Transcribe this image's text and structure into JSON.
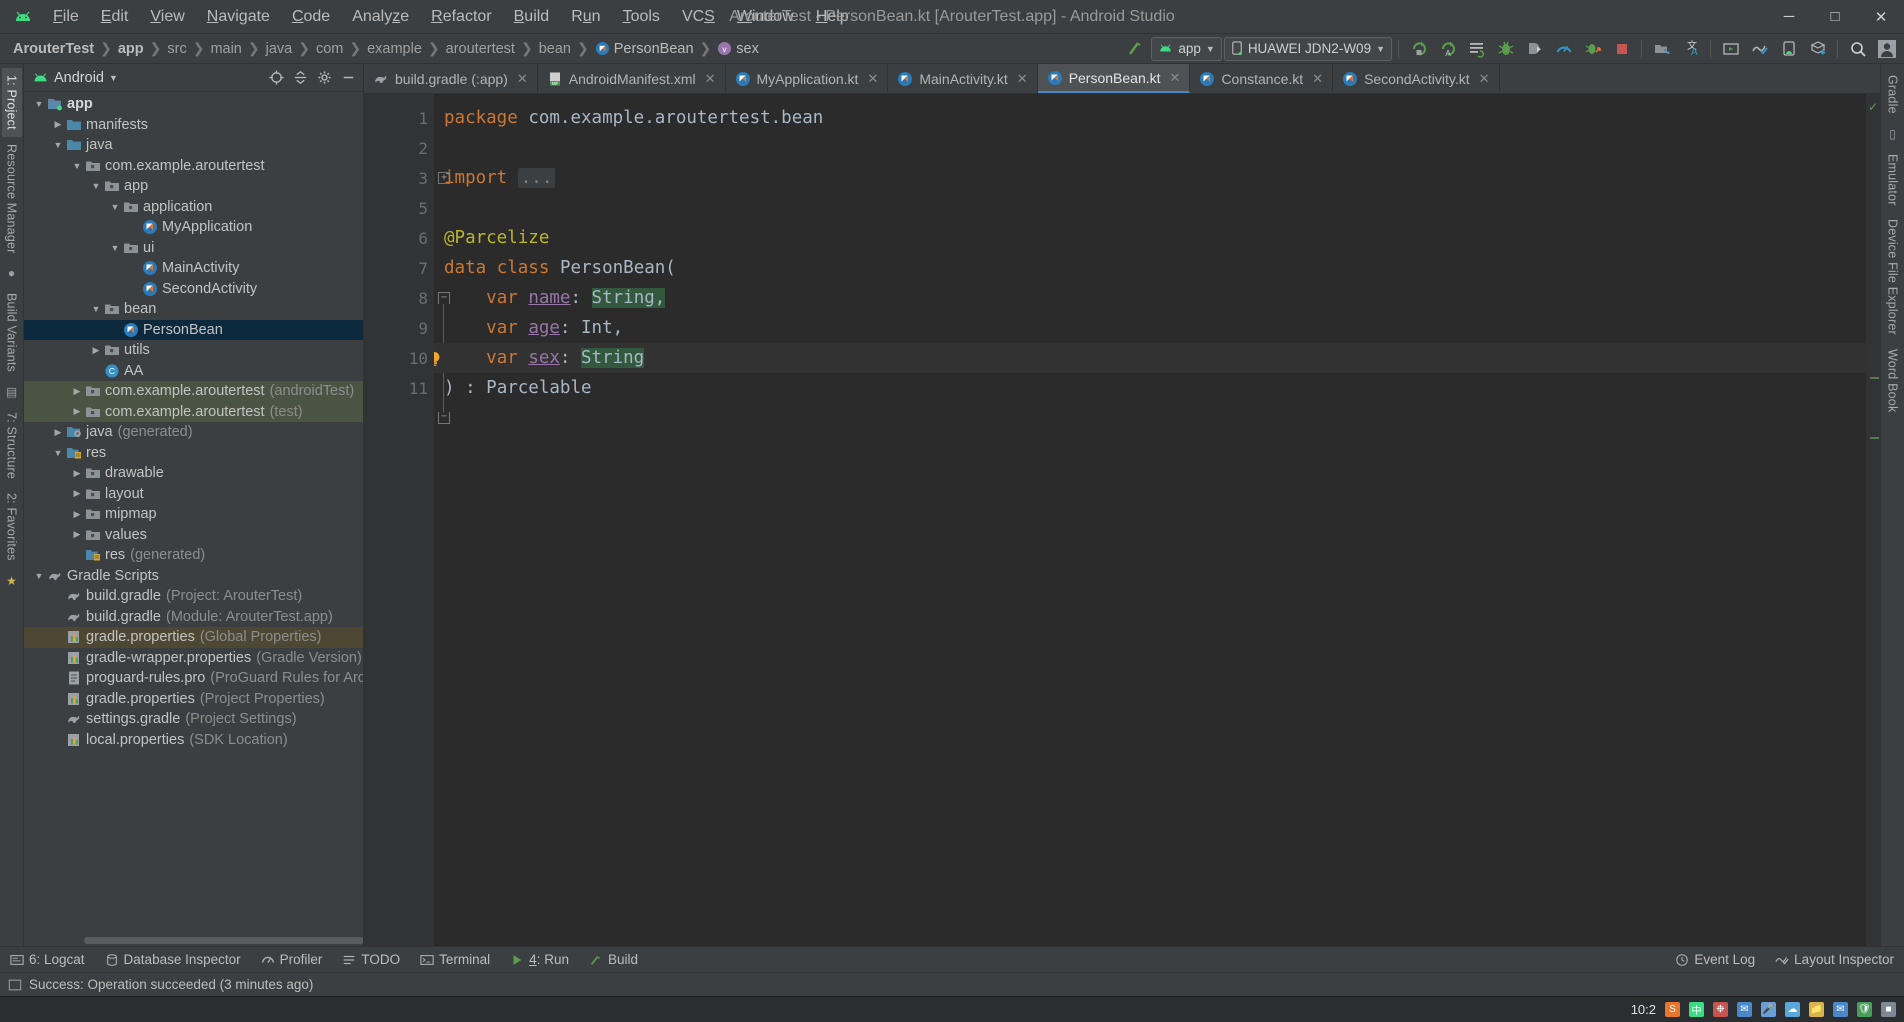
{
  "window": {
    "title": "ArouterTest - PersonBean.kt [ArouterTest.app] - Android Studio",
    "minimize": "─",
    "maximize": "☐",
    "close": "✕"
  },
  "menu": {
    "items": [
      {
        "label": "File",
        "mnemonic": "F"
      },
      {
        "label": "Edit",
        "mnemonic": "E"
      },
      {
        "label": "View",
        "mnemonic": "V"
      },
      {
        "label": "Navigate",
        "mnemonic": "N"
      },
      {
        "label": "Code",
        "mnemonic": "C"
      },
      {
        "label": "Analyze",
        "mnemonic": "z"
      },
      {
        "label": "Refactor",
        "mnemonic": "R"
      },
      {
        "label": "Build",
        "mnemonic": "B"
      },
      {
        "label": "Run",
        "mnemonic": "u"
      },
      {
        "label": "Tools",
        "mnemonic": "T"
      },
      {
        "label": "VCS",
        "mnemonic": "S"
      },
      {
        "label": "Window",
        "mnemonic": "W"
      },
      {
        "label": "Help",
        "mnemonic": "H"
      }
    ]
  },
  "breadcrumbs": [
    {
      "label": "ArouterTest",
      "icon": "",
      "style": "bold"
    },
    {
      "label": "app",
      "icon": "",
      "style": "bold"
    },
    {
      "label": "src",
      "icon": "",
      "style": "dim"
    },
    {
      "label": "main",
      "icon": "",
      "style": "dim"
    },
    {
      "label": "java",
      "icon": "",
      "style": "dim"
    },
    {
      "label": "com",
      "icon": "",
      "style": "dim"
    },
    {
      "label": "example",
      "icon": "",
      "style": "dim"
    },
    {
      "label": "aroutertest",
      "icon": "",
      "style": "dim"
    },
    {
      "label": "bean",
      "icon": "",
      "style": "dim"
    },
    {
      "label": "PersonBean",
      "icon": "kotlin-class-icon",
      "style": "normal"
    },
    {
      "label": "sex",
      "icon": "variable-icon",
      "style": "normal"
    }
  ],
  "toolbar": {
    "run_config": "app",
    "device": "HUAWEI JDN2-W09",
    "icons": [
      "make-project-icon",
      "run-icon",
      "run-with-coverage-icon",
      "apply-changes-icon",
      "debug-icon",
      "attach-debugger-icon",
      "profiler-icon",
      "stop-icon",
      "sdk-manager-icon",
      "avd-manager-icon",
      "translate-icon",
      "logcat-icon",
      "layout-inspector-icon",
      "device-explorer-icon",
      "build-variants-icon",
      "search-icon",
      "account-icon"
    ]
  },
  "left_strip": {
    "tabs": [
      {
        "label": "1: Project",
        "active": true
      },
      {
        "label": "Resource Manager",
        "active": false
      },
      {
        "label": "Build Variants",
        "active": false
      },
      {
        "label": "7: Structure",
        "active": false
      },
      {
        "label": "2: Favorites",
        "active": false
      }
    ]
  },
  "right_strip": {
    "tabs": [
      {
        "label": "Gradle",
        "active": false
      },
      {
        "label": "Emulator",
        "active": false
      },
      {
        "label": "Device File Explorer",
        "active": false
      },
      {
        "label": "Word Book",
        "active": false
      }
    ]
  },
  "project_panel": {
    "title": "Android",
    "header_icons": [
      "target-icon",
      "collapse-all-icon",
      "settings-icon",
      "hide-icon"
    ],
    "tree": [
      {
        "indent": 0,
        "arrow": "down",
        "icon": "module-icon",
        "label": "app",
        "sub": "",
        "bold": true,
        "state": ""
      },
      {
        "indent": 1,
        "arrow": "right",
        "icon": "folder-icon",
        "label": "manifests",
        "sub": "",
        "bold": false,
        "state": ""
      },
      {
        "indent": 1,
        "arrow": "down",
        "icon": "folder-icon",
        "label": "java",
        "sub": "",
        "bold": false,
        "state": ""
      },
      {
        "indent": 2,
        "arrow": "down",
        "icon": "package-icon",
        "label": "com.example.aroutertest",
        "sub": "",
        "bold": false,
        "state": ""
      },
      {
        "indent": 3,
        "arrow": "down",
        "icon": "package-icon",
        "label": "app",
        "sub": "",
        "bold": false,
        "state": ""
      },
      {
        "indent": 4,
        "arrow": "down",
        "icon": "package-icon",
        "label": "application",
        "sub": "",
        "bold": false,
        "state": ""
      },
      {
        "indent": 5,
        "arrow": "none",
        "icon": "kotlin-class-icon",
        "label": "MyApplication",
        "sub": "",
        "bold": false,
        "state": ""
      },
      {
        "indent": 4,
        "arrow": "down",
        "icon": "package-icon",
        "label": "ui",
        "sub": "",
        "bold": false,
        "state": ""
      },
      {
        "indent": 5,
        "arrow": "none",
        "icon": "kotlin-class-icon",
        "label": "MainActivity",
        "sub": "",
        "bold": false,
        "state": ""
      },
      {
        "indent": 5,
        "arrow": "none",
        "icon": "kotlin-class-icon",
        "label": "SecondActivity",
        "sub": "",
        "bold": false,
        "state": ""
      },
      {
        "indent": 3,
        "arrow": "down",
        "icon": "package-icon",
        "label": "bean",
        "sub": "",
        "bold": false,
        "state": ""
      },
      {
        "indent": 4,
        "arrow": "none",
        "icon": "kotlin-class-icon",
        "label": "PersonBean",
        "sub": "",
        "bold": false,
        "state": "sel"
      },
      {
        "indent": 3,
        "arrow": "right",
        "icon": "package-icon",
        "label": "utils",
        "sub": "",
        "bold": false,
        "state": ""
      },
      {
        "indent": 3,
        "arrow": "none",
        "icon": "java-class-icon",
        "label": "AA",
        "sub": "",
        "bold": false,
        "state": ""
      },
      {
        "indent": 2,
        "arrow": "right",
        "icon": "package-icon",
        "label": "com.example.aroutertest",
        "sub": "(androidTest)",
        "bold": false,
        "state": "test"
      },
      {
        "indent": 2,
        "arrow": "right",
        "icon": "package-icon",
        "label": "com.example.aroutertest",
        "sub": "(test)",
        "bold": false,
        "state": "test"
      },
      {
        "indent": 1,
        "arrow": "right",
        "icon": "generated-icon",
        "label": "java",
        "sub": "(generated)",
        "bold": false,
        "state": ""
      },
      {
        "indent": 1,
        "arrow": "down",
        "icon": "res-icon",
        "label": "res",
        "sub": "",
        "bold": false,
        "state": ""
      },
      {
        "indent": 2,
        "arrow": "right",
        "icon": "package-icon",
        "label": "drawable",
        "sub": "",
        "bold": false,
        "state": ""
      },
      {
        "indent": 2,
        "arrow": "right",
        "icon": "package-icon",
        "label": "layout",
        "sub": "",
        "bold": false,
        "state": ""
      },
      {
        "indent": 2,
        "arrow": "right",
        "icon": "package-icon",
        "label": "mipmap",
        "sub": "",
        "bold": false,
        "state": ""
      },
      {
        "indent": 2,
        "arrow": "right",
        "icon": "package-icon",
        "label": "values",
        "sub": "",
        "bold": false,
        "state": ""
      },
      {
        "indent": 2,
        "arrow": "none",
        "icon": "res-icon",
        "label": "res",
        "sub": "(generated)",
        "bold": false,
        "state": ""
      },
      {
        "indent": 0,
        "arrow": "down",
        "icon": "gradle-icon",
        "label": "Gradle Scripts",
        "sub": "",
        "bold": false,
        "state": ""
      },
      {
        "indent": 1,
        "arrow": "none",
        "icon": "gradle-icon",
        "label": "build.gradle",
        "sub": "(Project: ArouterTest)",
        "bold": false,
        "state": ""
      },
      {
        "indent": 1,
        "arrow": "none",
        "icon": "gradle-icon",
        "label": "build.gradle",
        "sub": "(Module: ArouterTest.app)",
        "bold": false,
        "state": ""
      },
      {
        "indent": 1,
        "arrow": "none",
        "icon": "properties-icon",
        "label": "gradle.properties",
        "sub": "(Global Properties)",
        "bold": false,
        "state": "olive"
      },
      {
        "indent": 1,
        "arrow": "none",
        "icon": "properties-icon",
        "label": "gradle-wrapper.properties",
        "sub": "(Gradle Version)",
        "bold": false,
        "state": ""
      },
      {
        "indent": 1,
        "arrow": "none",
        "icon": "file-icon",
        "label": "proguard-rules.pro",
        "sub": "(ProGuard Rules for Aroute",
        "bold": false,
        "state": ""
      },
      {
        "indent": 1,
        "arrow": "none",
        "icon": "properties-icon",
        "label": "gradle.properties",
        "sub": "(Project Properties)",
        "bold": false,
        "state": ""
      },
      {
        "indent": 1,
        "arrow": "none",
        "icon": "gradle-icon",
        "label": "settings.gradle",
        "sub": "(Project Settings)",
        "bold": false,
        "state": ""
      },
      {
        "indent": 1,
        "arrow": "none",
        "icon": "properties-icon",
        "label": "local.properties",
        "sub": "(SDK Location)",
        "bold": false,
        "state": ""
      }
    ]
  },
  "editor_tabs": [
    {
      "label": "build.gradle (:app)",
      "icon": "gradle-icon",
      "active": false
    },
    {
      "label": "AndroidManifest.xml",
      "icon": "manifest-icon",
      "active": false
    },
    {
      "label": "MyApplication.kt",
      "icon": "kotlin-class-icon",
      "active": false
    },
    {
      "label": "MainActivity.kt",
      "icon": "kotlin-class-icon",
      "active": false
    },
    {
      "label": "PersonBean.kt",
      "icon": "kotlin-class-icon",
      "active": true
    },
    {
      "label": "Constance.kt",
      "icon": "kotlin-class-icon",
      "active": false
    },
    {
      "label": "SecondActivity.kt",
      "icon": "kotlin-class-icon",
      "active": false
    }
  ],
  "code": {
    "filename": "PersonBean.kt",
    "line_numbers": [
      "1",
      "2",
      "3",
      "5",
      "6",
      "7",
      "8",
      "9",
      "10",
      "11"
    ],
    "lines": [
      {
        "num": "1",
        "text": "package com.example.aroutertest.bean"
      },
      {
        "num": "2",
        "text": ""
      },
      {
        "num": "3",
        "text": "import ..."
      },
      {
        "num": "5",
        "text": ""
      },
      {
        "num": "6",
        "text": "@Parcelize"
      },
      {
        "num": "7",
        "text": "data class PersonBean("
      },
      {
        "num": "8",
        "text": "    var name: String,"
      },
      {
        "num": "9",
        "text": "    var age: Int,"
      },
      {
        "num": "10",
        "text": "    var sex: String"
      },
      {
        "num": "11",
        "text": ") : Parcelable"
      }
    ],
    "tokens": {
      "package_kw": "package",
      "package_name": "com.example.aroutertest.bean",
      "import_kw": "import",
      "import_fold": "...",
      "annotation": "@Parcelize",
      "data_kw": "data",
      "class_kw": "class",
      "class_name": "PersonBean(",
      "var_kw": "var",
      "name_prop": "name",
      "name_type": "String,",
      "age_prop": "age",
      "age_type": "Int,",
      "sex_prop": "sex",
      "sex_type": "String",
      "close_paren": ") : ",
      "parcelable": "Parcelable",
      "colon": ": "
    },
    "gutter_marks": {
      "line7": "recursion-icon",
      "line10": "lightbulb-icon"
    }
  },
  "bottom_tools": {
    "left": [
      {
        "label": "6: Logcat",
        "icon": "logcat-icon"
      },
      {
        "label": "Database Inspector",
        "icon": "database-icon"
      },
      {
        "label": "Profiler",
        "icon": "profiler-icon"
      },
      {
        "label": "TODO",
        "icon": "todo-icon"
      },
      {
        "label": "Terminal",
        "icon": "terminal-icon"
      },
      {
        "label": "4: Run",
        "icon": "run-icon"
      },
      {
        "label": "Build",
        "icon": "build-icon"
      }
    ],
    "right": [
      {
        "label": "Event Log",
        "icon": "event-log-icon"
      },
      {
        "label": "Layout Inspector",
        "icon": "layout-inspector-icon"
      }
    ]
  },
  "statusbar": {
    "message": "Success: Operation succeeded (3 minutes ago)",
    "icon": "info-icon"
  },
  "taskbar": {
    "time": "10:2",
    "tray_icons": [
      "sogou-icon",
      "ime-icon",
      "flower-icon",
      "chat-icon",
      "mic-icon",
      "cloud-icon",
      "folder-icon",
      "mail-icon",
      "shield-icon",
      "battery-icon"
    ]
  },
  "colors": {
    "bg_chrome": "#3c3f41",
    "bg_editor": "#2b2b2b",
    "gutter": "#313335",
    "accent_blue": "#4a88c7",
    "selection": "#0d293e",
    "test_green": "#4b5443",
    "olive": "#4e4733",
    "kw_orange": "#cc7832",
    "annotation_yellow": "#bbb529",
    "type_blue": "#a9b7c6",
    "prop_purple": "#9876aa",
    "highlight_green": "#32593d",
    "android_green": "#3ddc84"
  }
}
